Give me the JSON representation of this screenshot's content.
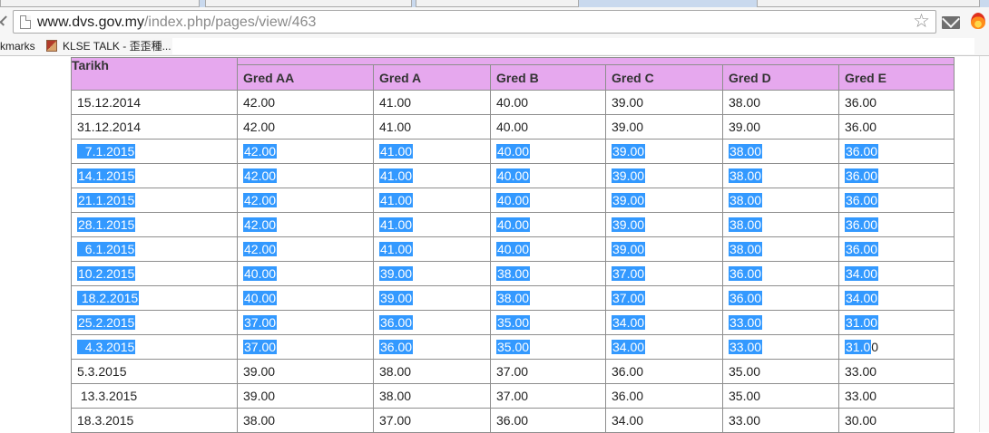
{
  "browser": {
    "url_host": "www.dvs.gov.my",
    "url_path": "/index.php/pages/view/463",
    "bookmarks": [
      {
        "label": "kmarks"
      },
      {
        "label": "KLSE TALK - 歪歪種..."
      }
    ]
  },
  "table": {
    "date_header": "Tarikh",
    "grade_headers": [
      "Gred AA",
      "Gred A",
      "Gred B",
      "Gred C",
      "Gred D",
      "Gred E"
    ],
    "rows": [
      {
        "date": "15.12.2014",
        "values": [
          "42.00",
          "41.00",
          "40.00",
          "39.00",
          "38.00",
          "36.00"
        ],
        "selected": false
      },
      {
        "date": "31.12.2014",
        "values": [
          "42.00",
          "41.00",
          "40.00",
          "39.00",
          "39.00",
          "36.00"
        ],
        "selected": false
      },
      {
        "date": "  7.1.2015",
        "values": [
          "42.00",
          "41.00",
          "40.00",
          "39.00",
          "38.00",
          "36.00"
        ],
        "selected": true
      },
      {
        "date": "14.1.2015",
        "values": [
          "42.00",
          "41.00",
          "40.00",
          "39.00",
          "38.00",
          "36.00"
        ],
        "selected": true
      },
      {
        "date": "21.1.2015",
        "values": [
          "42.00",
          "41.00",
          "40.00",
          "39.00",
          "38.00",
          "36.00"
        ],
        "selected": true
      },
      {
        "date": "28.1.2015",
        "values": [
          "42.00",
          "41.00",
          "40.00",
          "39.00",
          "38.00",
          "36.00"
        ],
        "selected": true
      },
      {
        "date": "  6.1.2015",
        "values": [
          "42.00",
          "41.00",
          "40.00",
          "39.00",
          "38.00",
          "36.00"
        ],
        "selected": true
      },
      {
        "date": "10.2.2015",
        "values": [
          "40.00",
          "39.00",
          "38.00",
          "37.00",
          "36.00",
          "34.00"
        ],
        "selected": true
      },
      {
        "date": " 18.2.2015",
        "values": [
          "40.00",
          "39.00",
          "38.00",
          "37.00",
          "36.00",
          "34.00"
        ],
        "selected": true
      },
      {
        "date": "25.2.2015",
        "values": [
          "37.00",
          "36.00",
          "35.00",
          "34.00",
          "33.00",
          "31.00"
        ],
        "selected": true
      },
      {
        "date": "  4.3.2015",
        "values": [
          "37.00",
          "36.00",
          "35.00",
          "34.00",
          "33.00",
          "31.00"
        ],
        "selected": true,
        "last_partial": true
      },
      {
        "date": "5.3.2015",
        "values": [
          "39.00",
          "38.00",
          "37.00",
          "36.00",
          "35.00",
          "33.00"
        ],
        "selected": false
      },
      {
        "date": " 13.3.2015",
        "values": [
          "39.00",
          "38.00",
          "37.00",
          "36.00",
          "35.00",
          "33.00"
        ],
        "selected": false
      },
      {
        "date": "18.3.2015",
        "values": [
          "38.00",
          "37.00",
          "36.00",
          "34.00",
          "33.00",
          "30.00"
        ],
        "selected": false
      }
    ]
  },
  "colors": {
    "header_bg": "#e6a8ee",
    "selection_bg": "#3399ff",
    "selection_text": "#ffffff",
    "border": "#8e8e8e"
  },
  "icons": [
    "page-icon",
    "star-icon",
    "mail-icon",
    "extension-flame-icon",
    "back-arrow-icon",
    "bookmark-favicon"
  ]
}
